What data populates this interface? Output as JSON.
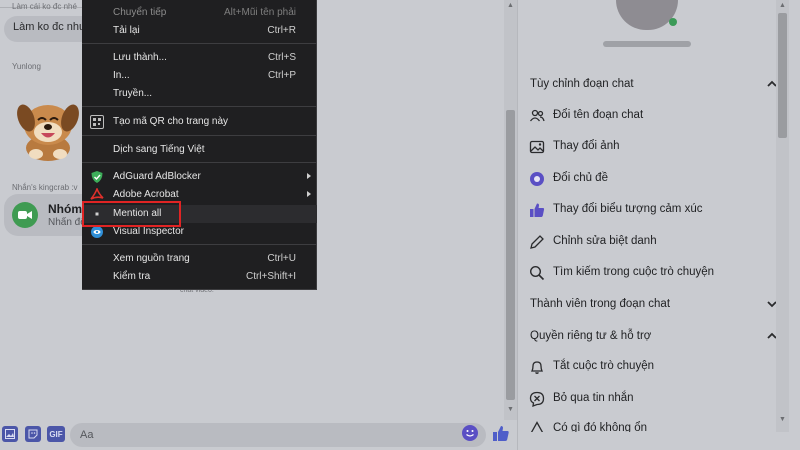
{
  "chat": {
    "faded_top": "Làm cái ko đc nhé",
    "top_bubble": "Làm ko đc như",
    "sender_1": "Yunlong",
    "sender_2": "Nhắn's kingcrab :v",
    "call_title": "Nhóm",
    "call_subtitle": "Nhấn để",
    "behind_text": "chat video."
  },
  "composer": {
    "gif_label": "GIF",
    "placeholder": "Aa"
  },
  "context_menu": {
    "items": [
      {
        "label": "Chuyển tiếp",
        "shortcut": "Alt+Mũi tên phải"
      },
      {
        "label": "Tải lại",
        "shortcut": "Ctrl+R"
      },
      {
        "label": "Lưu thành...",
        "shortcut": "Ctrl+S"
      },
      {
        "label": "In...",
        "shortcut": "Ctrl+P"
      },
      {
        "label": "Truyền...",
        "shortcut": ""
      },
      {
        "label": "Tạo mã QR cho trang này",
        "shortcut": ""
      },
      {
        "label": "Dịch sang Tiếng Việt",
        "shortcut": ""
      },
      {
        "label": "AdGuard AdBlocker",
        "shortcut": ""
      },
      {
        "label": "Adobe Acrobat",
        "shortcut": ""
      },
      {
        "label": "Mention all",
        "shortcut": ""
      },
      {
        "label": "Visual Inspector",
        "shortcut": ""
      },
      {
        "label": "Xem nguồn trang",
        "shortcut": "Ctrl+U"
      },
      {
        "label": "Kiểm tra",
        "shortcut": "Ctrl+Shift+I"
      }
    ],
    "highlight_color": "#e02424"
  },
  "panel": {
    "section_customize": "Tùy chỉnh đoạn chat",
    "rename": "Đổi tên đoạn chat",
    "change_photo": "Thay đổi ảnh",
    "change_theme": "Đổi chủ đề",
    "change_emoji": "Thay đổi biểu tượng cảm xúc",
    "edit_nickname": "Chỉnh sửa biệt danh",
    "search": "Tìm kiếm trong cuộc trò chuyện",
    "section_members": "Thành viên trong đoạn chat",
    "section_privacy": "Quyền riêng tư & hỗ trợ",
    "mute": "Tắt cuộc trò chuyện",
    "ignore": "Bỏ qua tin nhắn",
    "something_wrong": "Có gì đó không ổn"
  },
  "colors": {
    "accent": "#5a4fc4",
    "call_green": "#3f9b52",
    "menu_bg": "#1f1f21"
  }
}
